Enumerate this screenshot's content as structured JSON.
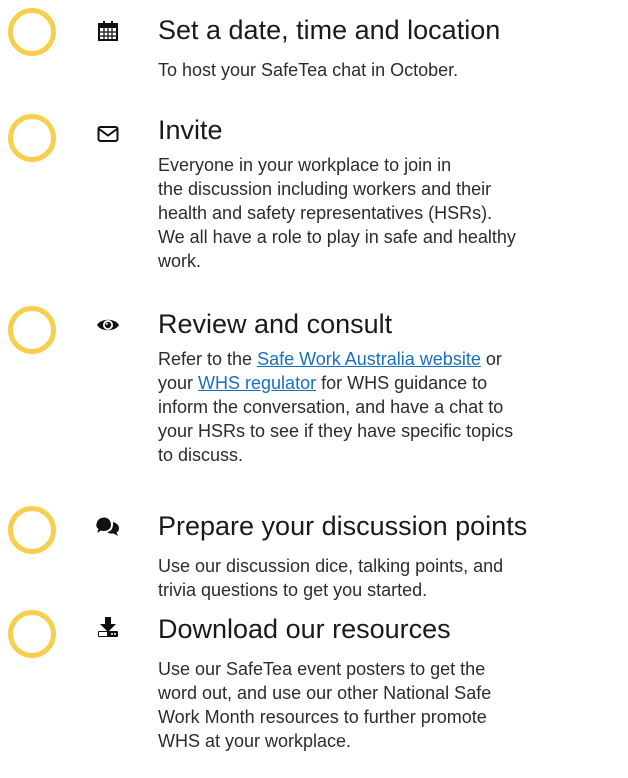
{
  "accent_color": "#f8ce4f",
  "link_color": "#1a6fbf",
  "steps": [
    {
      "icon": "calendar-icon",
      "title": "Set a date, time and location",
      "desc_lines": [
        "To host your SafeTea chat in October."
      ]
    },
    {
      "icon": "envelope-icon",
      "title": "Invite",
      "desc_lines": [
        "Everyone in your workplace to join in",
        "the discussion including workers and their",
        "health and safety representatives (HSRs).",
        "We all have a role to play in safe and healthy",
        "work."
      ]
    },
    {
      "icon": "eye-icon",
      "title": "Review and consult",
      "desc": {
        "l1_pre": "Refer to the ",
        "l1_link": "Safe Work Australia website",
        "l1_post": " or",
        "l2_pre": "your ",
        "l2_link": "WHS regulator",
        "l2_post": " for WHS guidance to",
        "l3": "inform the conversation, and have a chat to",
        "l4": "your HSRs to see if they have specific topics",
        "l5": "to discuss."
      }
    },
    {
      "icon": "comments-icon",
      "title": "Prepare your discussion points",
      "desc_lines": [
        "Use our discussion dice, talking points, and",
        "trivia questions to get you started."
      ]
    },
    {
      "icon": "download-icon",
      "title": "Download our resources",
      "desc_lines": [
        "Use our SafeTea event posters to get the",
        "word out, and use our other National Safe",
        "Work Month resources to further promote",
        "WHS at your workplace."
      ]
    }
  ]
}
